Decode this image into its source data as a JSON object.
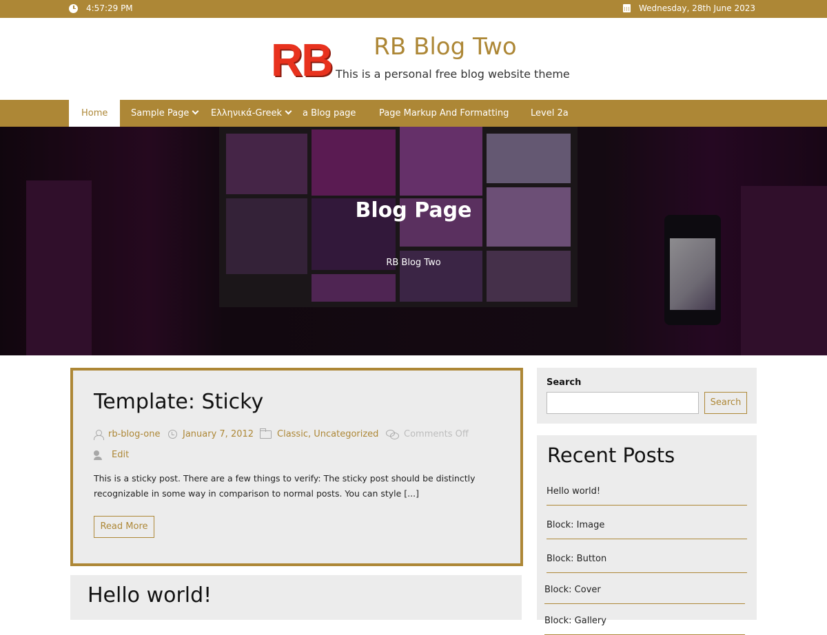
{
  "topbar": {
    "time": "4:57:29 PM",
    "date": "Wednesday, 28th June 2023"
  },
  "header": {
    "logo_text": "RB",
    "site_title": "RB Blog Two",
    "tagline": "This is a personal free blog website theme"
  },
  "nav": {
    "items": [
      {
        "label": "Home"
      },
      {
        "label": "Sample Page"
      },
      {
        "label": "Ελληνικά-Greek"
      },
      {
        "label": "a Blog page"
      },
      {
        "label": "Page Markup And Formatting"
      },
      {
        "label": "Level 2a"
      }
    ]
  },
  "hero": {
    "title": "Blog Page",
    "subtitle": "RB Blog Two"
  },
  "posts": [
    {
      "title": "Template: Sticky",
      "author": "rb-blog-one",
      "date": "January 7, 2012",
      "categories": "Classic, Uncategorized",
      "comments": "Comments Off",
      "edit": "Edit",
      "excerpt": "This is a sticky post. There are a few things to verify: The sticky post should be distinctly recognizable in some way in comparison to normal posts. You can style [...]",
      "read_more": "Read More"
    },
    {
      "title": "Hello world!"
    }
  ],
  "sidebar": {
    "search": {
      "label": "Search",
      "button": "Search",
      "placeholder": ""
    },
    "recent": {
      "heading": "Recent Posts",
      "items": [
        "Hello world!",
        "Block: Image",
        "Block: Button",
        "Block: Cover",
        "Block: Gallery"
      ]
    }
  },
  "colors": {
    "accent": "#ad8736",
    "widget_bg": "#ececec"
  }
}
